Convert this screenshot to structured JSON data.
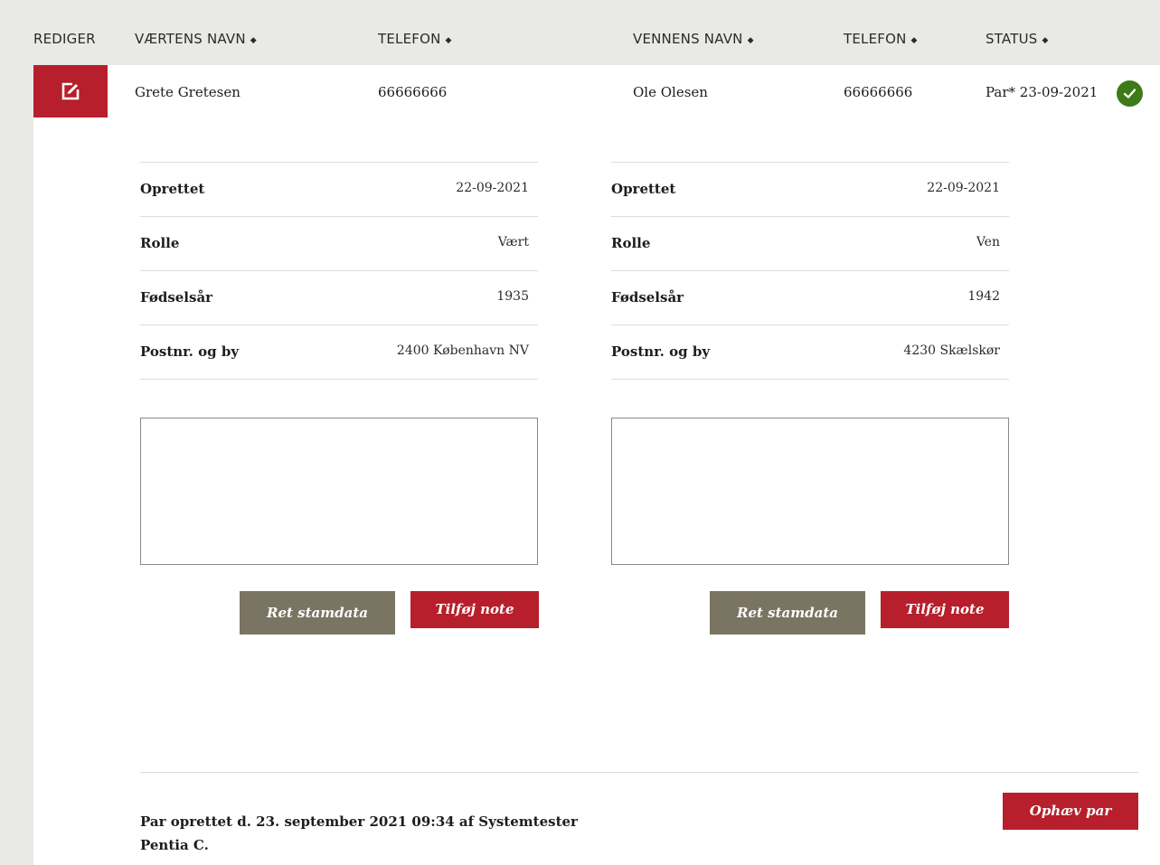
{
  "header": {
    "col_edit": "REDIGER",
    "col_host_name": "VÆRTENS NAVN",
    "col_host_phone": "TELEFON",
    "col_friend_name": "VENNENS NAVN",
    "col_friend_phone": "TELEFON",
    "col_status": "STATUS",
    "sort_glyph": "◆"
  },
  "row": {
    "host_name": "Grete Gretesen",
    "host_phone": "66666666",
    "friend_name": "Ole Olesen",
    "friend_phone": "66666666",
    "status": "Par* 23-09-2021",
    "status_icon": "check-circle-icon",
    "edit_icon": "edit-icon"
  },
  "host_details": [
    {
      "label": "Oprettet",
      "value": "22-09-2021"
    },
    {
      "label": "Rolle",
      "value": "Vært"
    },
    {
      "label": "Fødselsår",
      "value": "1935"
    },
    {
      "label": "Postnr. og by",
      "value": "2400 København NV"
    }
  ],
  "friend_details": [
    {
      "label": "Oprettet",
      "value": "22-09-2021"
    },
    {
      "label": "Rolle",
      "value": "Ven"
    },
    {
      "label": "Fødselsår",
      "value": "1942"
    },
    {
      "label": "Postnr. og by",
      "value": "4230 Skælskør"
    }
  ],
  "actions": {
    "edit_master_data": "Ret stamdata",
    "add_note": "Tilføj note",
    "dissolve_pair": "Ophæv par"
  },
  "footer": {
    "created_text": "Par oprettet d. 23. september 2021 09:34 af Systemtester Pentia C."
  },
  "colors": {
    "accent_red": "#b61f2b",
    "button_gray": "#7a7462",
    "status_green": "#3d7a18",
    "background": "#e9e9e5"
  }
}
